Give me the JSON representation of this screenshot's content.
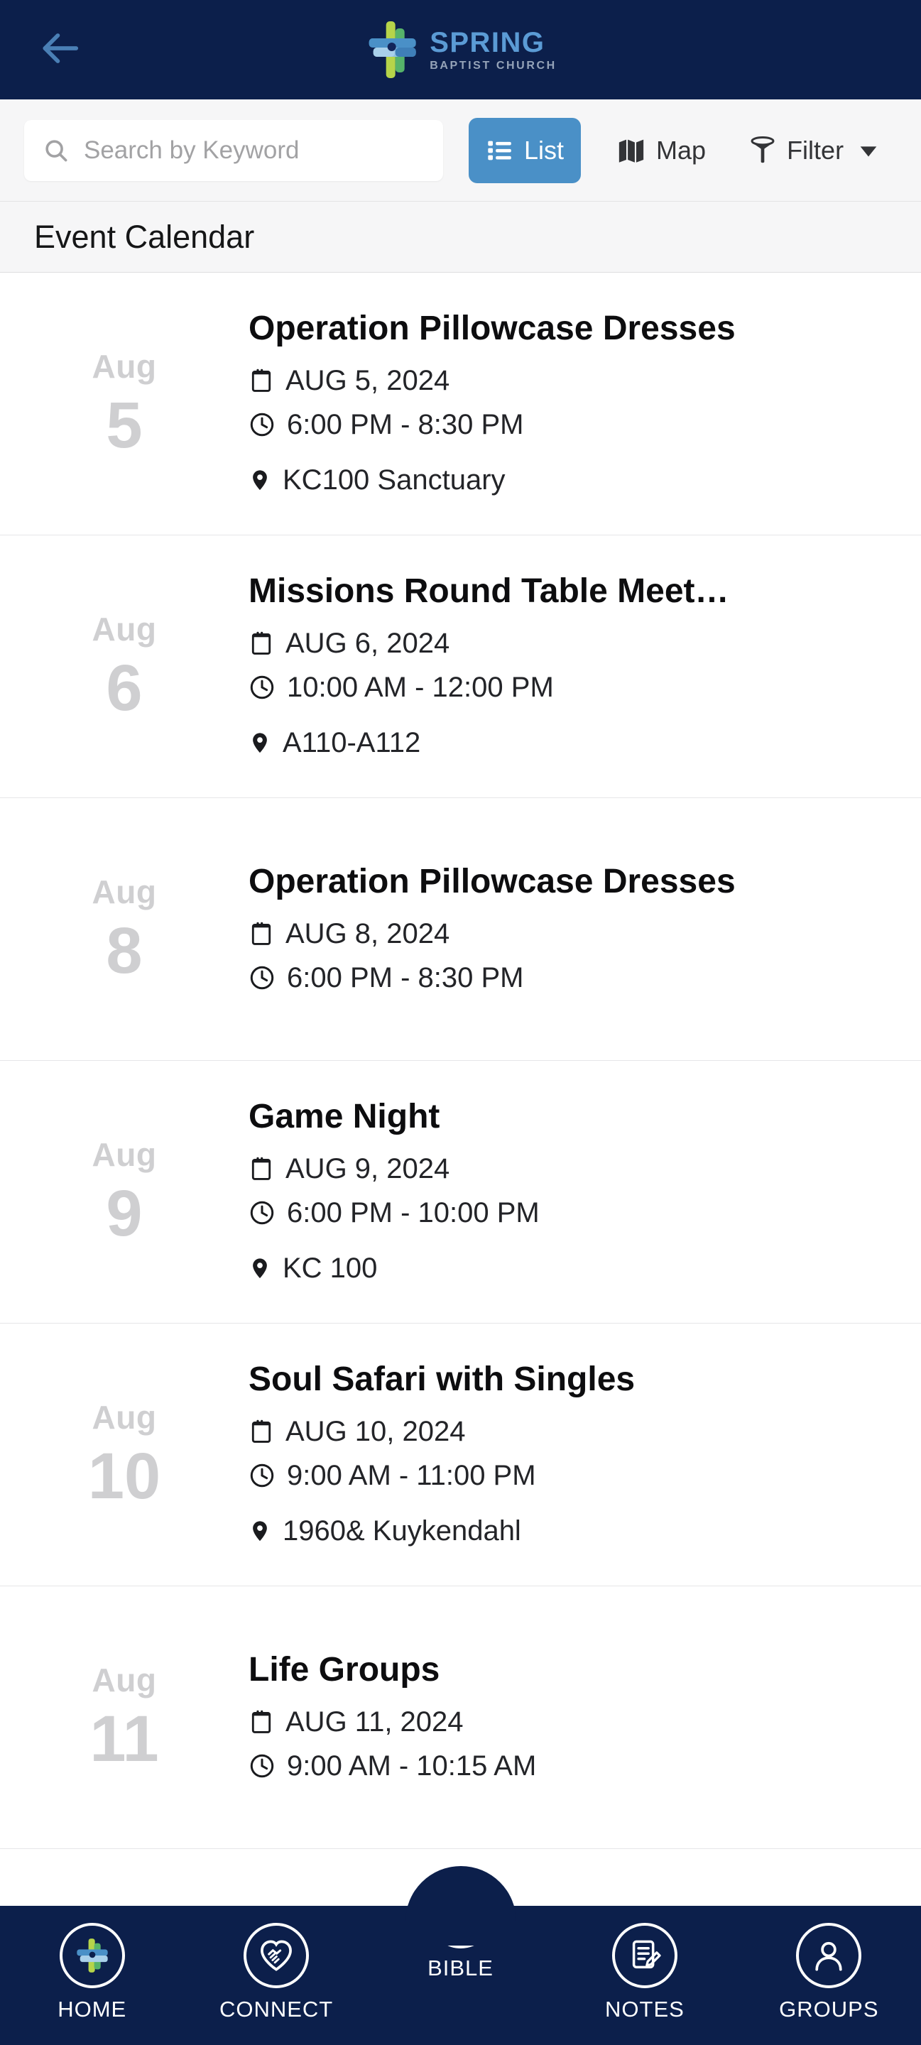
{
  "header": {
    "back_icon": "back-arrow-icon",
    "brand_name": "SPRING",
    "brand_subtitle": "BAPTIST CHURCH",
    "bar_color": "#0c1f4b",
    "back_arrow_color": "#4a7fb5",
    "brand_name_color": "#5b9bd5",
    "brand_sub_color": "#95a3b8"
  },
  "toolbar": {
    "search_placeholder": "Search by Keyword",
    "search_value": "",
    "search_icon": "search-icon",
    "list_label": "List",
    "list_icon": "list-bullets-icon",
    "list_active_color": "#4a90c7",
    "map_label": "Map",
    "map_icon": "map-folded-icon",
    "filter_label": "Filter",
    "filter_icon": "funnel-icon",
    "filter_caret_icon": "chevron-down-icon",
    "background": "#f6f6f7"
  },
  "page": {
    "title": "Event Calendar"
  },
  "events": [
    {
      "month": "Aug",
      "day": "5",
      "title": "Operation Pillowcase Dresses",
      "date": "AUG 5, 2024",
      "time": "6:00 PM - 8:30 PM",
      "location": "KC100 Sanctuary"
    },
    {
      "month": "Aug",
      "day": "6",
      "title": "Missions Round Table Meet…",
      "date": "AUG 6, 2024",
      "time": "10:00 AM - 12:00 PM",
      "location": "A110-A112"
    },
    {
      "month": "Aug",
      "day": "8",
      "title": "Operation Pillowcase Dresses",
      "date": "AUG 8, 2024",
      "time": "6:00 PM - 8:30 PM",
      "location": ""
    },
    {
      "month": "Aug",
      "day": "9",
      "title": "Game Night",
      "date": "AUG 9, 2024",
      "time": "6:00 PM - 10:00 PM",
      "location": "KC 100"
    },
    {
      "month": "Aug",
      "day": "10",
      "title": "Soul Safari with Singles",
      "date": "AUG 10, 2024",
      "time": "9:00 AM - 11:00 PM",
      "location": "1960& Kuykendahl"
    },
    {
      "month": "Aug",
      "day": "11",
      "title": "Life Groups",
      "date": "AUG 11, 2024",
      "time": "9:00 AM - 10:15 AM",
      "location": ""
    }
  ],
  "event_icons": {
    "date": "calendar-icon",
    "time": "clock-icon",
    "location": "map-pin-icon"
  },
  "bottomnav": {
    "background": "#0c1f4b",
    "items": [
      {
        "label": "HOME",
        "icon": "cross-logo-icon",
        "raised": false
      },
      {
        "label": "CONNECT",
        "icon": "handshake-heart-icon",
        "raised": false
      },
      {
        "label": "BIBLE",
        "icon": "bible-book-icon",
        "raised": true
      },
      {
        "label": "NOTES",
        "icon": "note-pencil-icon",
        "raised": false
      },
      {
        "label": "GROUPS",
        "icon": "person-icon",
        "raised": false
      }
    ]
  }
}
